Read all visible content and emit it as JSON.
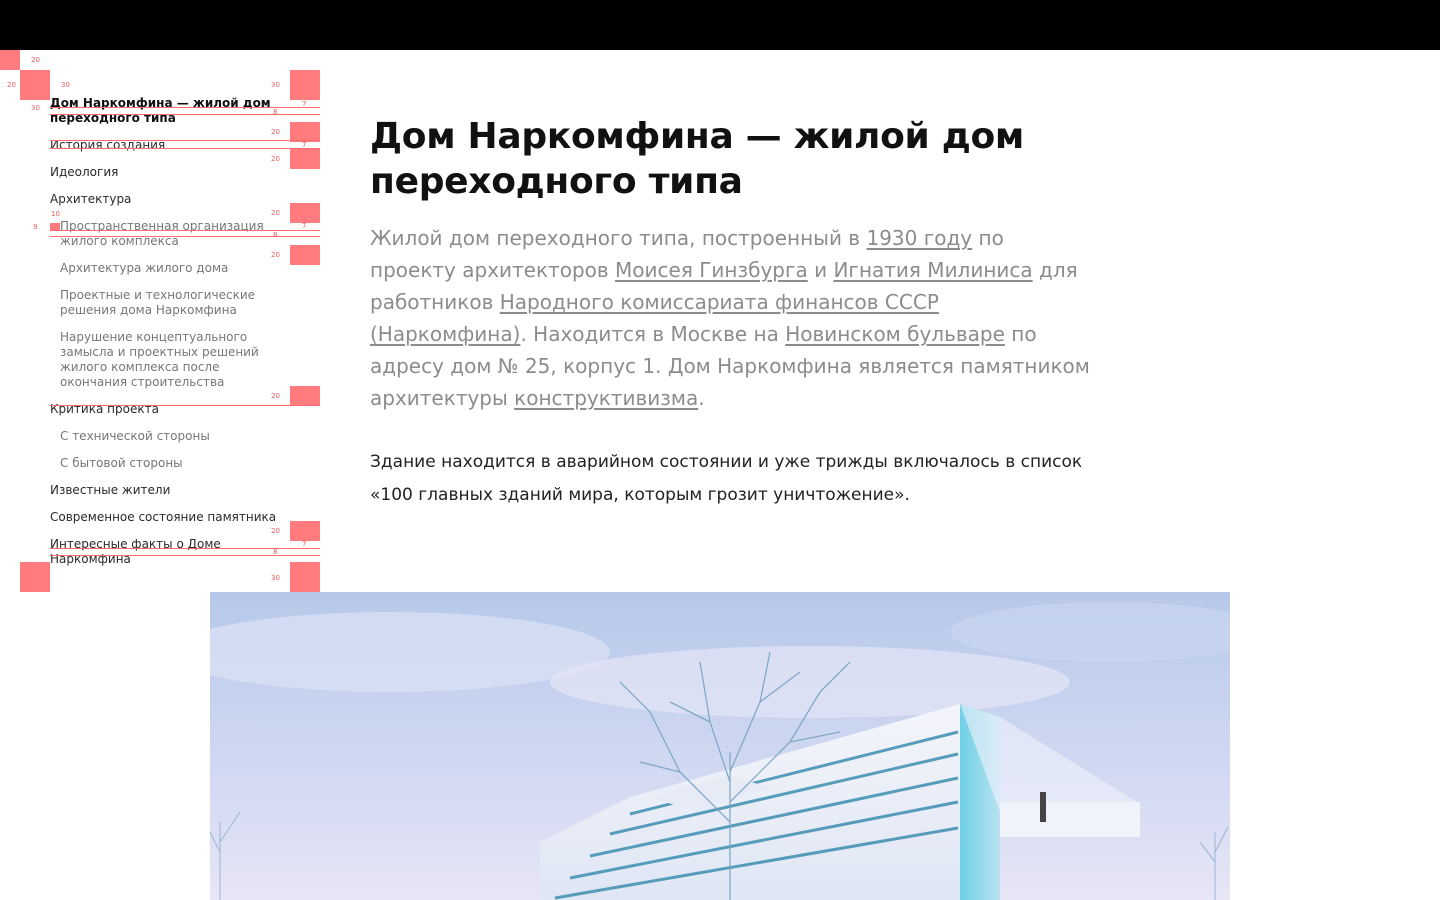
{
  "toc": {
    "items": [
      {
        "label": "Дом Наркомфина — жилой дом переходного типа",
        "level": 1,
        "active": true
      },
      {
        "label": "История создания",
        "level": 1
      },
      {
        "label": "Идеология",
        "level": 1
      },
      {
        "label": "Архитектура",
        "level": 1
      },
      {
        "label": "Пространственная организация жилого комплекса",
        "level": 2
      },
      {
        "label": "Архитектура жилого дома",
        "level": 2
      },
      {
        "label": "Проектные и технологические решения дома Наркомфина",
        "level": 2
      },
      {
        "label": "Нарушение концептуального замысла и проектных решений жилого комплекса после окончания строительства",
        "level": 2
      },
      {
        "label": "Критика проекта",
        "level": 1
      },
      {
        "label": "С технической стороны",
        "level": 2
      },
      {
        "label": "С бытовой стороны",
        "level": 2
      },
      {
        "label": "Известные жители",
        "level": 1
      },
      {
        "label": "Современное состояние памятника",
        "level": 1
      },
      {
        "label": "Интересные факты о Доме Наркомфина",
        "level": 1
      }
    ]
  },
  "overlay_numbers": {
    "n20": "20",
    "n30": "30",
    "n10": "10",
    "n9": "9",
    "n8": "8",
    "n7": "7"
  },
  "article": {
    "title": "Дом Наркомфина — жилой дом переходного типа",
    "lead": {
      "t1": "Жилой дом переходного типа, построенный в ",
      "link_year": "1930 году",
      "t2": " по проекту архитекторов ",
      "link_ginzburg": "Моисея Гинзбурга",
      "t3": " и ",
      "link_milinis": "Игнатия Милиниса",
      "t4": " для работников ",
      "link_narkomfin": "Народного комиссариата финансов СССР (Наркомфина)",
      "t5": ". Находится в Москве на ",
      "link_boulevard": "Новинском бульваре",
      "t6": " по адресу дом № 25, корпус 1. Дом Наркомфина является памятником архитектуры ",
      "link_constructivism": "конструктивизма",
      "t7": "."
    },
    "body": "Здание находится в аварийном состоянии и уже трижды включалось в список «100 главных зданий мира, которым грозит уничтожение»."
  },
  "colors": {
    "overlay": "#ff7b7e",
    "topbar": "#000000",
    "lead_text": "#8c8c8c"
  }
}
